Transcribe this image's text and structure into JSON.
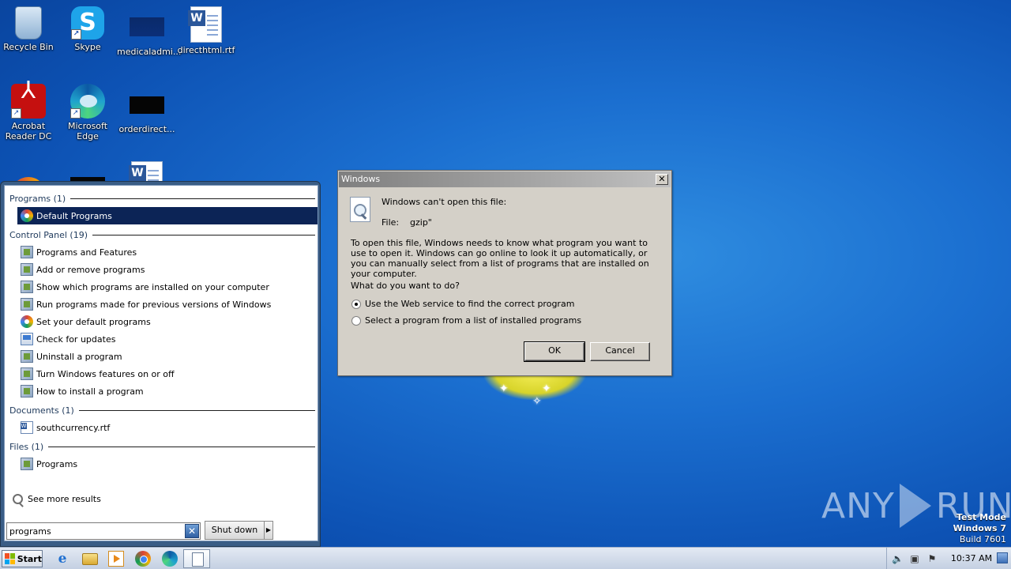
{
  "desktop": {
    "icons": [
      {
        "label": "Recycle Bin",
        "icon": "recycle-bin-icon"
      },
      {
        "label": "Skype",
        "icon": "skype-icon"
      },
      {
        "label": "medicaladmi...",
        "icon": "file-icon"
      },
      {
        "label": "directhtml.rtf",
        "icon": "word-doc-icon"
      },
      {
        "label": "Acrobat Reader DC",
        "icon": "acrobat-icon"
      },
      {
        "label": "Microsoft Edge",
        "icon": "edge-icon"
      },
      {
        "label": "orderdirect...",
        "icon": "file-icon"
      }
    ]
  },
  "start_menu": {
    "groups": {
      "programs": "Programs (1)",
      "control_panel": "Control Panel (19)",
      "documents": "Documents (1)",
      "files": "Files (1)"
    },
    "programs": [
      "Default Programs"
    ],
    "control_panel": [
      "Programs and Features",
      "Add or remove programs",
      "Show which programs are installed on your computer",
      "Run programs made for previous versions of Windows",
      "Set your default programs",
      "Check for updates",
      "Uninstall a program",
      "Turn Windows features on or off",
      "How to install a program"
    ],
    "documents": [
      "southcurrency.rtf"
    ],
    "files": [
      "Programs"
    ],
    "see_more": "See more results",
    "search_value": "programs",
    "shutdown_label": "Shut down"
  },
  "dialog": {
    "title": "Windows",
    "heading": "Windows can't open this file:",
    "file_label": "File:",
    "file_name": "gzip\"",
    "explanation": "To open this file, Windows needs to know what program you want to use to open it. Windows can go online to look it up automatically, or you can manually select from a list of programs that are installed on your computer.",
    "question": "What do you want to do?",
    "options": [
      {
        "label": "Use the Web service to find the correct program",
        "selected": true
      },
      {
        "label": "Select a program from a list of installed programs",
        "selected": false
      }
    ],
    "ok_label": "OK",
    "cancel_label": "Cancel"
  },
  "taskbar": {
    "start_label": "Start",
    "clock": "10:37 AM"
  },
  "watermark": {
    "any": "ANY",
    "run": "RUN",
    "test_mode": "Test Mode",
    "os": "Windows 7",
    "build": "Build 7601"
  }
}
